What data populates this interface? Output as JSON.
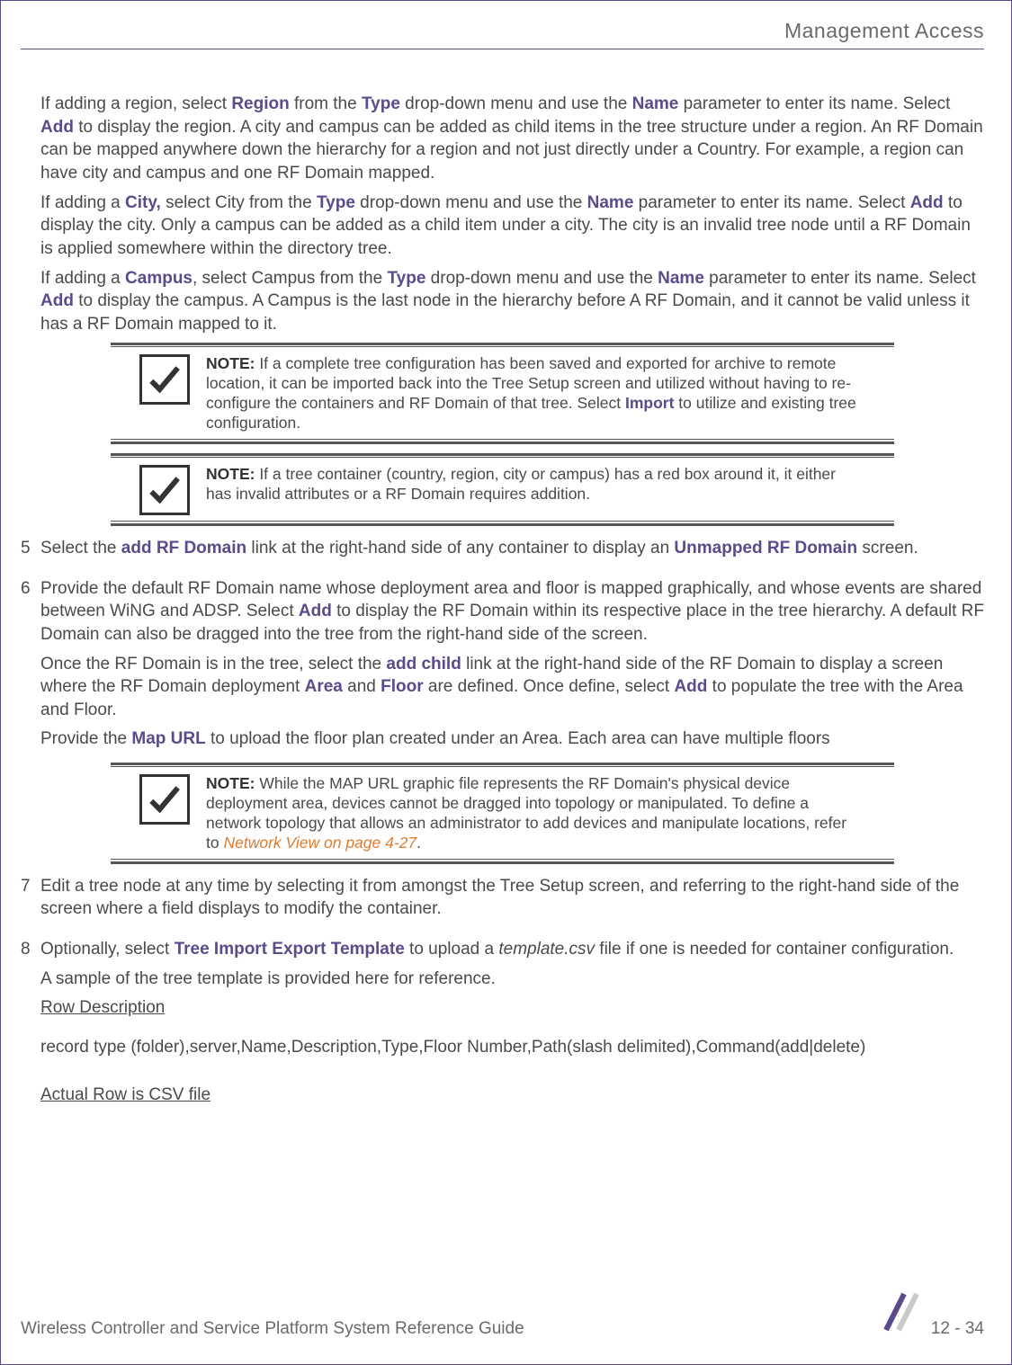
{
  "header": {
    "section_title": "Management Access"
  },
  "intro": {
    "p1_a": "If adding a region, select ",
    "p1_b": " from the ",
    "p1_c": " drop-down menu and use the ",
    "p1_d": " parameter to enter its name. Select ",
    "p1_e": " to display the region. A city and campus can be added as child items in the tree structure under a region. An RF Domain can be mapped anywhere down the hierarchy for a region and not just directly under a Country. For example, a region can have city and campus and one RF Domain mapped.",
    "region": "Region",
    "type": "Type",
    "name": "Name",
    "add": "Add",
    "p2_a": "If adding a ",
    "p2_b": " select City from the ",
    "p2_c": " drop-down menu and use the ",
    "p2_d": " parameter to enter its name. Select ",
    "p2_e": " to display the city. Only a campus can be added as a child item under a city. The city is an invalid tree node until a RF Domain is applied somewhere within the directory tree.",
    "city": "City,",
    "p3_a": "If adding a ",
    "p3_b": ", select Campus from the ",
    "p3_c": " drop-down menu and use the ",
    "p3_d": " parameter to enter its name. Select ",
    "p3_e": " to display the campus. A Campus is the last node in the hierarchy before A RF Domain, and it cannot be valid unless it has a RF Domain mapped to it.",
    "campus": "Campus"
  },
  "notes": {
    "label": "NOTE:",
    "n1_a": " If a complete tree configuration has been saved and exported for archive to remote location, it can be imported back into the Tree Setup screen and utilized without having to re-configure the containers and RF Domain of that tree. Select ",
    "n1_import": "Import",
    "n1_b": " to utilize and existing tree configuration.",
    "n2": " If a tree container (country, region, city or campus) has a red box around it, it either has invalid attributes or a RF Domain requires addition.",
    "n3_a": " While the MAP URL graphic file represents the RF Domain's physical device deployment area, devices cannot be dragged into topology or manipulated. To define a network topology that allows an administrator to add devices and manipulate locations, refer to ",
    "n3_link": "Network View on page 4-27",
    "n3_b": "."
  },
  "steps": {
    "s5": {
      "num": "5",
      "a": "Select the ",
      "add_rf": "add RF Domain",
      "b": " link at the right-hand side of any container to display an ",
      "unmapped": "Unmapped RF Domain",
      "c": " screen."
    },
    "s6": {
      "num": "6",
      "p1_a": "Provide the default RF Domain name whose deployment area and floor is mapped graphically, and whose events are shared between WiNG and ADSP. Select ",
      "add": "Add",
      "p1_b": " to display the RF Domain within its respective place in the tree hierarchy. A default RF Domain can also be dragged into the tree from the right-hand side of the screen.",
      "p2_a": "Once the RF Domain is in the tree, select the ",
      "add_child": "add child",
      "p2_b": " link at the right-hand side of the RF Domain to display a screen where the RF Domain deployment ",
      "area": "Area",
      "p2_c": " and ",
      "floor": "Floor",
      "p2_d": " are defined. Once define, select ",
      "p2_e": " to populate the tree with the Area and Floor.",
      "p3_a": "Provide the ",
      "map_url": "Map URL",
      "p3_b": " to upload the floor plan created under an Area. Each area can have multiple floors"
    },
    "s7": {
      "num": "7",
      "text": "Edit a tree node at any time by selecting it from amongst the Tree Setup screen, and referring to the right-hand side of the screen where a field displays to modify the container."
    },
    "s8": {
      "num": "8",
      "p1_a": "Optionally, select ",
      "template": "Tree Import Export Template",
      "p1_b": " to upload a ",
      "csv": "template.csv",
      "p1_c": " file if one is needed for container configuration.",
      "p2": "A sample of the tree template is provided here for reference.",
      "rowdesc": "Row Description",
      "record": "record type (folder),server,Name,Description,Type,Floor Number,Path(slash delimited),Command(add|delete)",
      "actual": "Actual Row is CSV file"
    }
  },
  "footer": {
    "guide": "Wireless Controller and Service Platform System Reference Guide",
    "page": "12 - 34"
  }
}
